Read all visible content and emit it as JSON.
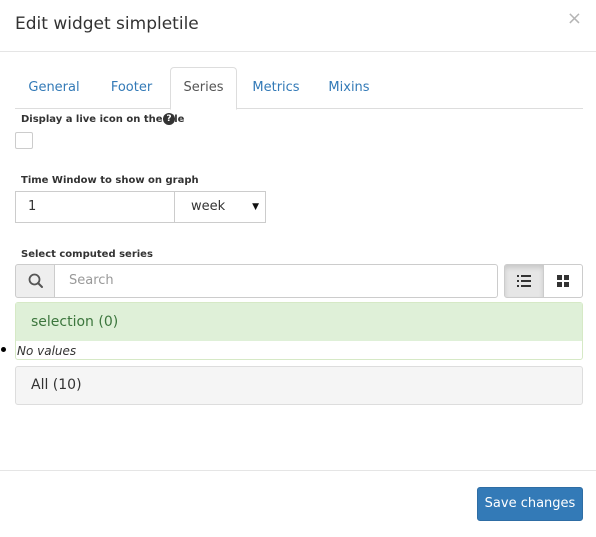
{
  "modal": {
    "title": "Edit widget simpletile",
    "close_glyph": "×"
  },
  "tabs": [
    {
      "label": "General",
      "active": false
    },
    {
      "label": "Footer",
      "active": false
    },
    {
      "label": "Series",
      "active": true
    },
    {
      "label": "Metrics",
      "active": false
    },
    {
      "label": "Mixins",
      "active": false
    }
  ],
  "live_icon": {
    "label": "Display a live icon on the tile",
    "help_icon": "question-circle-icon",
    "checked": false
  },
  "time_window": {
    "label": "Time Window to show on graph",
    "value": "1",
    "unit": "week"
  },
  "series": {
    "label": "Select computed series",
    "search_placeholder": "Search",
    "icons": {
      "search": "search-icon",
      "list_view": "list-view-icon",
      "grid_view": "grid-view-icon"
    },
    "selection_header": "selection (0)",
    "no_values": "No values",
    "all_header": "All (10)"
  },
  "footer": {
    "save_label": "Save changes"
  },
  "colors": {
    "primary": "#337ab7",
    "success_bg": "#dff0d8",
    "success_text": "#3c763d",
    "panel_bg": "#f5f5f5"
  }
}
